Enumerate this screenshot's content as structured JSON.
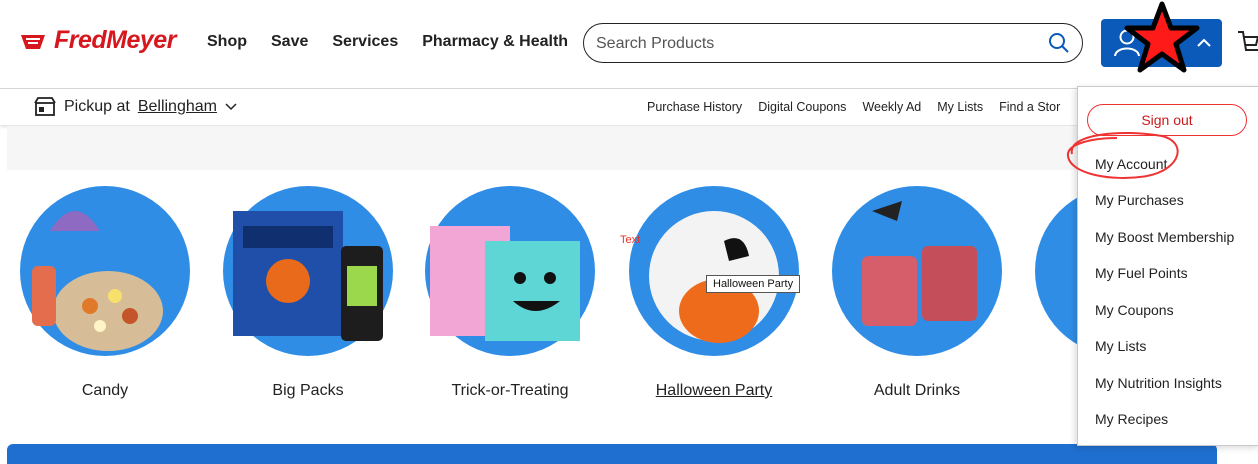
{
  "header": {
    "logo_text": "FredMeyer",
    "nav": [
      "Shop",
      "Save",
      "Services",
      "Pharmacy & Health"
    ],
    "search_placeholder": "Search Products",
    "brand_color": "#d6171e",
    "accent_color": "#0b59b8"
  },
  "subbar": {
    "pickup_prefix": "Pickup at",
    "pickup_location": "Bellingham",
    "links": [
      "Purchase History",
      "Digital Coupons",
      "Weekly Ad",
      "My Lists",
      "Find a Stor"
    ]
  },
  "categories": [
    {
      "label": "Candy"
    },
    {
      "label": "Big Packs"
    },
    {
      "label": "Trick-or-Treating"
    },
    {
      "label": "Halloween Party"
    },
    {
      "label": "Adult Drinks"
    }
  ],
  "tooltip": "Halloween Party",
  "annotation_text": "Text",
  "account_menu": {
    "sign_out": "Sign out",
    "items": [
      "My Account",
      "My Purchases",
      "My Boost Membership",
      "My Fuel Points",
      "My Coupons",
      "My Lists",
      "My Nutrition Insights",
      "My Recipes"
    ]
  }
}
